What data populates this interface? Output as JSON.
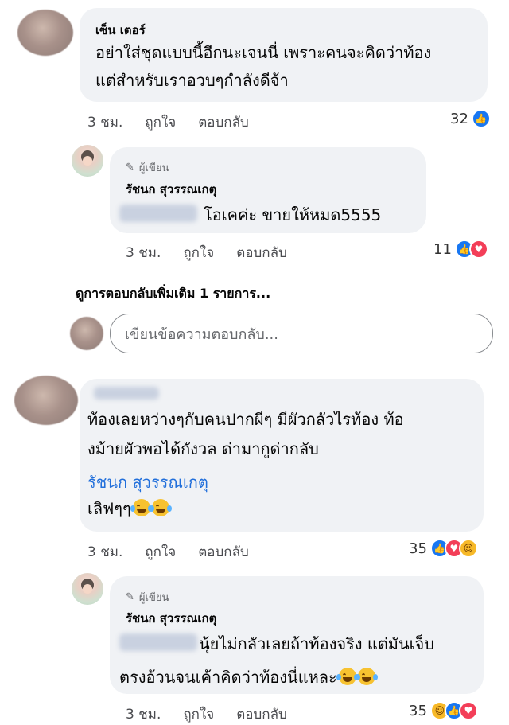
{
  "comment1": {
    "name": "เซ็น เตอร์",
    "line1": "อย่าใส่ชุดแบบนี้อีกนะเจนนี่ เพราะคนจะคิดว่าท้อง",
    "line2": "แต่สำหรับเราอวบๆกำลังดีจ้า",
    "time": "3 ชม.",
    "like": "ถูกใจ",
    "reply": "ตอบกลับ",
    "reaction_count": "32",
    "reaction_icons": [
      "like-icon"
    ]
  },
  "reply1": {
    "badge": "ผู้เขียน",
    "name": "รัชนก สุวรรณเกตุ",
    "text": "โอเคค่ะ ขายให้หมด5555",
    "time": "3 ชม.",
    "like": "ถูกใจ",
    "reply": "ตอบกลับ",
    "reaction_count": "11",
    "reaction_icons": [
      "like-icon",
      "love-icon"
    ]
  },
  "more_replies": "ดูการตอบกลับเพิ่มเติม 1 รายการ...",
  "reply_box": {
    "placeholder": "เขียนข้อความตอบกลับ..."
  },
  "comment2": {
    "line1": "ท้องเลยหว่างๆกับคนปากผีๆ  มีผัวกลัวไรท้อง  ท้อ",
    "line2": "งม้ายผัวพอได้กังวล  ด่ามากูด่ากลับ",
    "mention": "รัชนก สุวรรณเกตุ",
    "line3": "เลิฟๆๆ",
    "time": "3 ชม.",
    "like": "ถูกใจ",
    "reply": "ตอบกลับ",
    "reaction_count": "35",
    "reaction_icons": [
      "like-icon",
      "love-icon",
      "haha-icon"
    ]
  },
  "reply2": {
    "badge": "ผู้เขียน",
    "name": "รัชนก สุวรรณเกตุ",
    "line1": "นุ้ยไม่กลัวเลยถ้าท้องจริง แต่มันเจ็บ",
    "line2": "ตรงอ้วนจนเค้าคิดว่าท้องนี่แหละ",
    "time": "3 ชม.",
    "like": "ถูกใจ",
    "reply": "ตอบกลับ",
    "reaction_count": "35",
    "reaction_icons": [
      "haha-icon",
      "like-icon",
      "love-icon"
    ]
  },
  "colors": {
    "bubble": "#f0f2f5",
    "mention": "#216fdb",
    "like": "#1877f2",
    "love": "#f33e58",
    "haha": "#f7b928"
  }
}
